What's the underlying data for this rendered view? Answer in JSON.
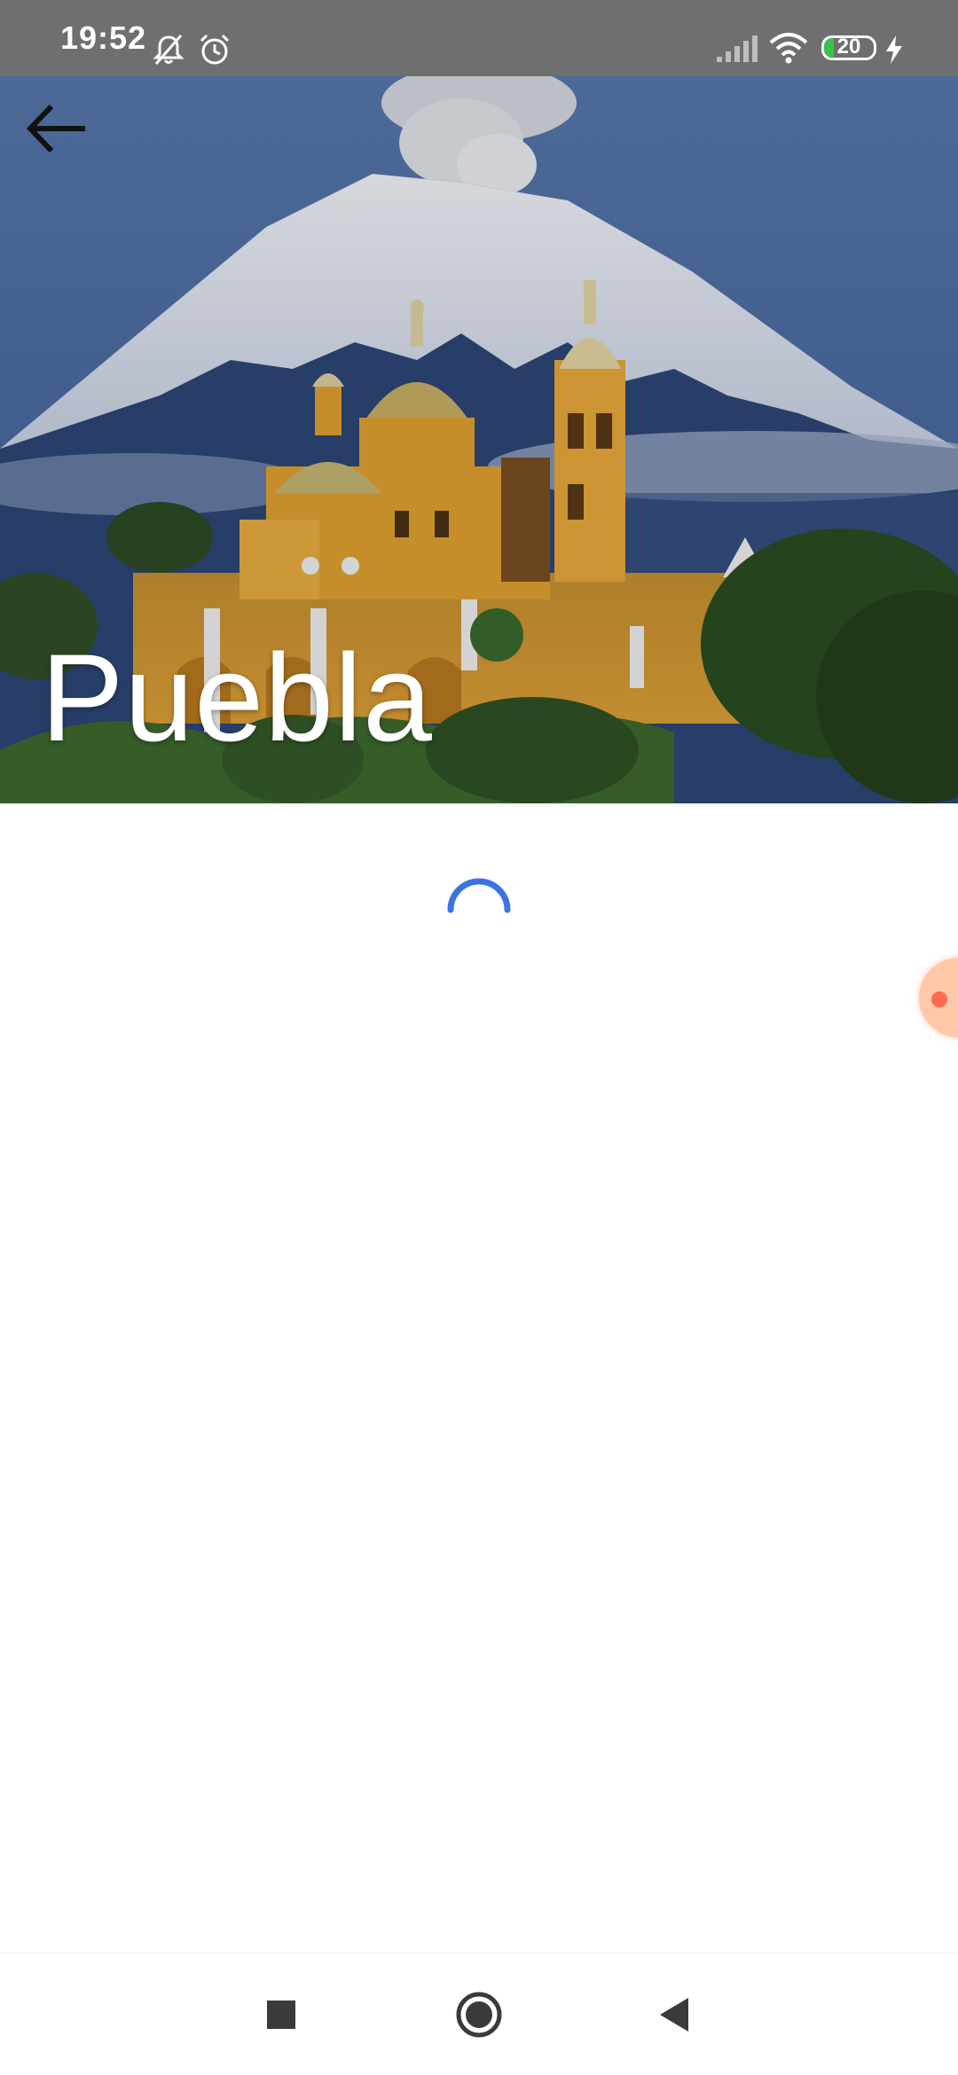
{
  "status_bar": {
    "time": "19:52",
    "battery_level": "20",
    "battery_fraction": 0.2,
    "icons": [
      "notifications-muted-icon",
      "alarm-icon",
      "signal-icon",
      "wifi-icon",
      "battery-icon",
      "charging-icon"
    ]
  },
  "header": {
    "title": "Puebla",
    "back_icon": "back-arrow-icon"
  },
  "hero_image": {
    "subject": "church-with-volcano-image"
  },
  "loading": {
    "icon": "loading-spinner-icon"
  },
  "nav_bar": {
    "recents_icon": "recents-square-icon",
    "home_icon": "home-circle-icon",
    "back_icon": "back-triangle-icon"
  },
  "colors": {
    "status_bar": "#6f6f6f",
    "spinner": "#3b74e0",
    "church": "#e9a93a",
    "sky": "#3e5f95",
    "battery": "#37c34a"
  }
}
